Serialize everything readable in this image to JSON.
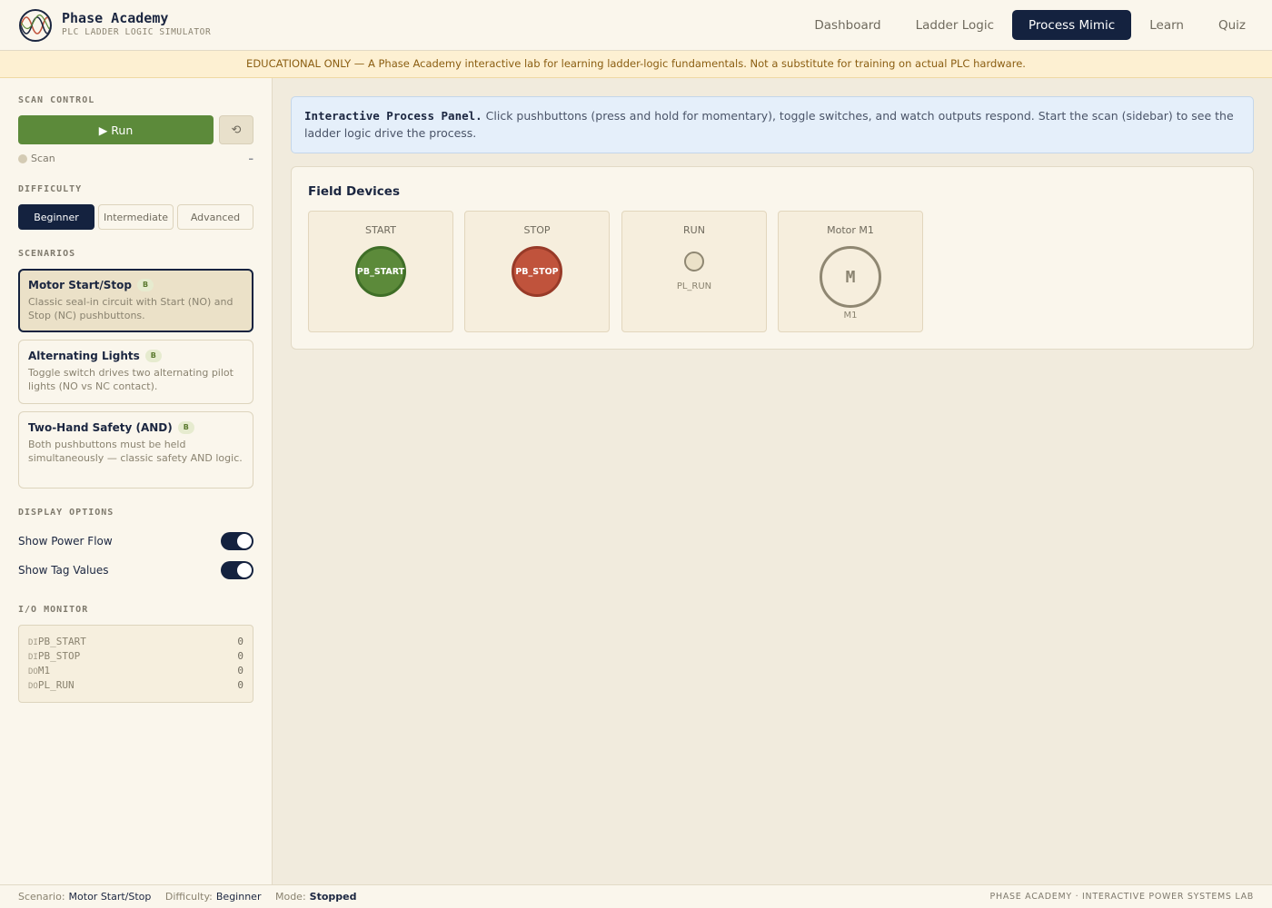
{
  "header": {
    "brand_name": "Phase Academy",
    "brand_sub": "PLC LADDER LOGIC SIMULATOR",
    "logo_icon": "sine-wave-logo-icon",
    "nav": [
      {
        "label": "Dashboard",
        "active": false
      },
      {
        "label": "Ladder Logic",
        "active": false
      },
      {
        "label": "Process Mimic",
        "active": true
      },
      {
        "label": "Learn",
        "active": false
      },
      {
        "label": "Quiz",
        "active": false
      }
    ]
  },
  "banner": "EDUCATIONAL ONLY — A Phase Academy interactive lab for learning ladder-logic fundamentals. Not a substitute for training on actual PLC hardware.",
  "sidebar": {
    "scan_control": {
      "title": "SCAN CONTROL",
      "run_label": "▶ Run",
      "reset_icon": "reset-icon",
      "reset_glyph": "⟲",
      "scan_label": "Scan",
      "scan_value": "–"
    },
    "difficulty": {
      "title": "DIFFICULTY",
      "options": [
        {
          "label": "Beginner",
          "active": true
        },
        {
          "label": "Intermediate",
          "active": false
        },
        {
          "label": "Advanced",
          "active": false
        }
      ]
    },
    "scenarios": {
      "title": "SCENARIOS",
      "items": [
        {
          "title": "Motor Start/Stop",
          "badge": "B",
          "desc": "Classic seal-in circuit with Start (NO) and Stop (NC) pushbuttons.",
          "active": true
        },
        {
          "title": "Alternating Lights",
          "badge": "B",
          "desc": "Toggle switch drives two alternating pilot lights (NO vs NC contact).",
          "active": false
        },
        {
          "title": "Two-Hand Safety (AND)",
          "badge": "B",
          "desc": "Both pushbuttons must be held simultaneously — classic safety AND logic.",
          "active": false
        }
      ]
    },
    "display_options": {
      "title": "DISPLAY OPTIONS",
      "items": [
        {
          "label": "Show Power Flow",
          "on": true
        },
        {
          "label": "Show Tag Values",
          "on": true
        }
      ]
    },
    "io_monitor": {
      "title": "I/O MONITOR",
      "rows": [
        {
          "type": "DI",
          "tag": "PB_START",
          "value": "0"
        },
        {
          "type": "DI",
          "tag": "PB_STOP",
          "value": "0"
        },
        {
          "type": "DO",
          "tag": "M1",
          "value": "0"
        },
        {
          "type": "DO",
          "tag": "PL_RUN",
          "value": "0"
        }
      ]
    }
  },
  "main": {
    "info_strong": "Interactive Process Panel.",
    "info_text": "Click pushbuttons (press and hold for momentary), toggle switches, and watch outputs respond. Start the scan (sidebar) to see the ladder logic drive the process.",
    "panel_title": "Field Devices",
    "devices": [
      {
        "title": "START",
        "tag": "PB_START"
      },
      {
        "title": "STOP",
        "tag": "PB_STOP"
      },
      {
        "title": "RUN",
        "tag": "PL_RUN"
      },
      {
        "title": "Motor M1",
        "symbol": "M",
        "tag": "M1"
      }
    ]
  },
  "footer": {
    "scenario_key": "Scenario:",
    "scenario_value": "Motor Start/Stop",
    "difficulty_key": "Difficulty:",
    "difficulty_value": "Beginner",
    "mode_key": "Mode:",
    "mode_value": "Stopped",
    "right": "PHASE ACADEMY · INTERACTIVE POWER SYSTEMS LAB"
  },
  "colors": {
    "navy": "#14223f",
    "green": "#5c8a3a",
    "red": "#c0533c",
    "cream": "#faf6ec"
  }
}
